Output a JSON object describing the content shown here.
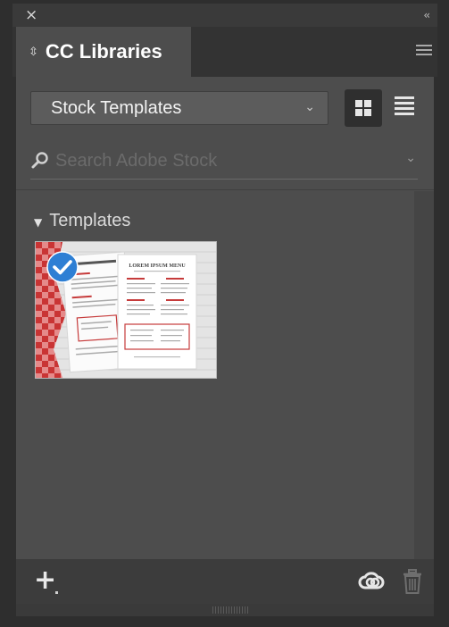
{
  "window": {
    "close_icon": "close-icon",
    "collapse_icon": "double-chevron-left-icon",
    "collapse_glyph": "‹‹"
  },
  "tab": {
    "title": "CC Libraries",
    "icon": "updown-arrows-icon",
    "menu_icon": "hamburger-menu-icon"
  },
  "library_select": {
    "selected": "Stock Templates",
    "icon": "chevron-down-icon"
  },
  "view_toggle": {
    "active": "grid",
    "grid_icon": "grid-view-icon",
    "list_icon": "list-view-icon"
  },
  "search": {
    "placeholder": "Search Adobe Stock",
    "value": "",
    "icon": "search-icon"
  },
  "section": {
    "title": "Templates",
    "expanded": true
  },
  "items": [
    {
      "type": "template",
      "selected": true,
      "menu_heading": "LOREM IPSUM MENU"
    }
  ],
  "footer": {
    "add_icon": "add-icon",
    "sync_icon": "creative-cloud-sync-icon",
    "delete_icon": "trash-icon"
  },
  "colors": {
    "panel": "#4d4d4d",
    "frame": "#2e2e2e",
    "check_badge": "#2e7fd4",
    "accent_red": "#c63b3b"
  }
}
